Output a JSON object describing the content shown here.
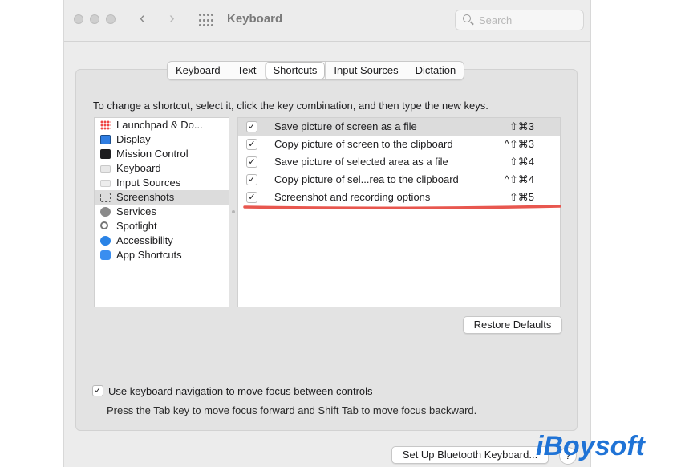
{
  "window": {
    "title": "Keyboard"
  },
  "search": {
    "placeholder": "Search"
  },
  "tabs": [
    {
      "label": "Keyboard"
    },
    {
      "label": "Text"
    },
    {
      "label": "Shortcuts"
    },
    {
      "label": "Input Sources"
    },
    {
      "label": "Dictation"
    }
  ],
  "active_tab": "Shortcuts",
  "instructions": "To change a shortcut, select it, click the key combination, and then type the new keys.",
  "categories": [
    {
      "label": "Launchpad & Do...",
      "icon": "launchpad-icon"
    },
    {
      "label": "Display",
      "icon": "display-icon"
    },
    {
      "label": "Mission Control",
      "icon": "mission-control-icon"
    },
    {
      "label": "Keyboard",
      "icon": "keyboard-icon"
    },
    {
      "label": "Input Sources",
      "icon": "input-sources-icon"
    },
    {
      "label": "Screenshots",
      "icon": "screenshot-icon"
    },
    {
      "label": "Services",
      "icon": "gear-icon"
    },
    {
      "label": "Spotlight",
      "icon": "magnifier-icon"
    },
    {
      "label": "Accessibility",
      "icon": "accessibility-icon"
    },
    {
      "label": "App Shortcuts",
      "icon": "app-store-icon"
    }
  ],
  "selected_category": "Screenshots",
  "shortcuts": [
    {
      "checked": true,
      "label": "Save picture of screen as a file",
      "keys": "⇧⌘3"
    },
    {
      "checked": true,
      "label": "Copy picture of screen to the clipboard",
      "keys": "^⇧⌘3"
    },
    {
      "checked": true,
      "label": "Save picture of selected area as a file",
      "keys": "⇧⌘4"
    },
    {
      "checked": true,
      "label": "Copy picture of sel...rea to the clipboard",
      "keys": "^⇧⌘4"
    },
    {
      "checked": true,
      "label": "Screenshot and recording options",
      "keys": "⇧⌘5"
    }
  ],
  "check_glyph": "✓",
  "restore_defaults_label": "Restore Defaults",
  "keyboard_navigation": {
    "checked": true,
    "label": "Use keyboard navigation to move focus between controls",
    "hint": "Press the Tab key to move focus forward and Shift Tab to move focus backward."
  },
  "bluetooth_button_label": "Set Up Bluetooth Keyboard...",
  "help_label": "?",
  "watermark": "iBoysoft",
  "colors": {
    "highlight_line": "#e8574f",
    "watermark": "#1f73d6",
    "selection": "#dcdcdc"
  }
}
